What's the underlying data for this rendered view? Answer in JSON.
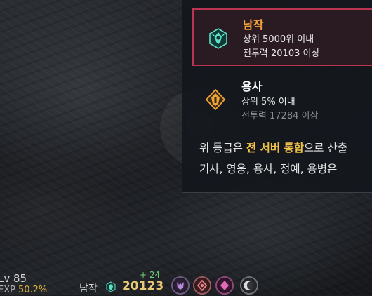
{
  "ranking_panel": {
    "tiers": [
      {
        "name": "남작",
        "line1": "상위 5000위 이내",
        "line2": "전투력 20103 이상",
        "icon": "baron-rank-emblem-icon",
        "name_color": "#f2a23c",
        "selected": true
      },
      {
        "name": "용사",
        "line1": "상위 5% 이내",
        "line2": "전투력 17284 이상",
        "icon": "hero-rank-emblem-icon",
        "name_color": "#ffffff",
        "selected": false
      }
    ],
    "description": {
      "line1_prefix": "위 등급은 ",
      "line1_highlight": "전 서버 통합",
      "line1_suffix": "으로 산출",
      "line2": "기사, 영웅, 용사, 정예, 용병은"
    },
    "accent_color": "#b93552",
    "highlight_color": "#f0c24a"
  },
  "hud": {
    "level_label": "Lv 85",
    "exp_label": "EXP",
    "exp_percent": "50.2%",
    "rank_name": "남작",
    "combat_power": "20123",
    "power_delta": "+ 24",
    "buff_icons": [
      "demon-buff-icon",
      "rune-buff-icon",
      "crystal-buff-icon",
      "moon-buff-icon"
    ]
  }
}
